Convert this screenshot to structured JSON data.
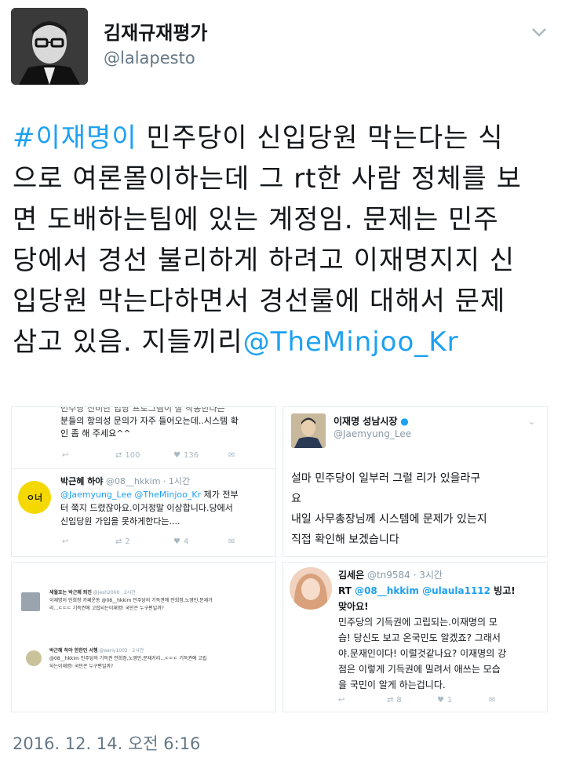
{
  "header": {
    "display_name": "김재규재평가",
    "handle": "@lalapesto"
  },
  "tweet": {
    "hashtag": "#이재명이",
    "line1_rest": " 민주당이 신입당원 막는다는 식",
    "line2": "으로 여론몰이하는데 그 rt한 사람 정체를 보",
    "line3": "면 도배하는팀에 있는 계정임. 문제는 민주",
    "line4": "당에서 경선 불리하게 하려고 이재명지지 신",
    "line5": "입당원 막는다하면서 경선룰에 대해서 문제",
    "line6_start": "삼고 있음. 지들끼리",
    "mention": "@TheMinjoo_Kr",
    "timestamp": "2016. 12. 14. 오전 6:16"
  },
  "panel1": {
    "top_line1": "민주당 신비한 입당 프로그램이 잘 작동한다는",
    "top_line2": "분들의 항의성 문의가 자주 들어오는데..시스템 확",
    "top_line3": "인 좀 해 주세요^^",
    "rt_count": "100",
    "like_count": "136",
    "reply_name": "박근혜 하야",
    "reply_meta": "@08__hkkim · 1시간",
    "reply_mention1": "@Jaemyung_Lee",
    "reply_mention2": "@TheMinjoo_Kr",
    "reply_l1_rest": " 제가 전부",
    "reply_l2": "터 쭉지 드렸잖아요.이거정말 이상합니다.당에서",
    "reply_l3": "신입당원 가입을 못하게한다는....",
    "reply_rt": "2",
    "reply_like": "4",
    "avatar_text": "ㅇ너"
  },
  "panel2": {
    "name": "이재명 성남시장",
    "handle": "@Jaemyung_Lee",
    "l1": "설마 민주당이 일부러 그럴 리가 있을라구",
    "l2": "요",
    "l3": "내일 사무총장님께 시스템에 문제가 있는지",
    "l4": "직접 확인해 보겠습니다"
  },
  "panel3": {
    "name1": "세월호는 박근혜 퇴진",
    "meta1": "@jesh2000 · 2시간",
    "l1a": "이재명이 민희청 카페운동 @08__hkkim 민주당의 기득권에 안희정,노영민,문재거",
    "l1b": "리...ㄷㄷㄷ 기득권에 고립되는이재명! 국민은 누구편일까?",
    "name2": "박근혜 하야 한한민 서행",
    "meta2": "@aeriy1002 · 2시간",
    "l2a": "@08__hkkim 민주당의 기득권 안희정,노영민,문재거리...ㄷㄷㄷ 기득권에 고립",
    "l2b": "되는이재명! 국민은 누구편일까?"
  },
  "panel4": {
    "name": "김세은",
    "meta": "@tn9584 · 3시간",
    "rt_prefix": "RT ",
    "mention1": "@08__hkkim",
    "mention2": "@ulaula1112",
    "rt_suffix": " 빙고!",
    "l2": "맞아요!",
    "l3": "민주당의 기득권에 고립되는.이재명의 모",
    "l4": "습! 당신도 보고 온국민도 알겠죠? 그래서",
    "l5": "야.문재인이다! 이럴것같나요? 이재명의 강",
    "l6": "점은 이렇게 기득권에 밀려서 애쓰는 모습",
    "l7": "을 국민이 알게 하는겁니다.",
    "rt_count": "8",
    "like_count": "1"
  }
}
